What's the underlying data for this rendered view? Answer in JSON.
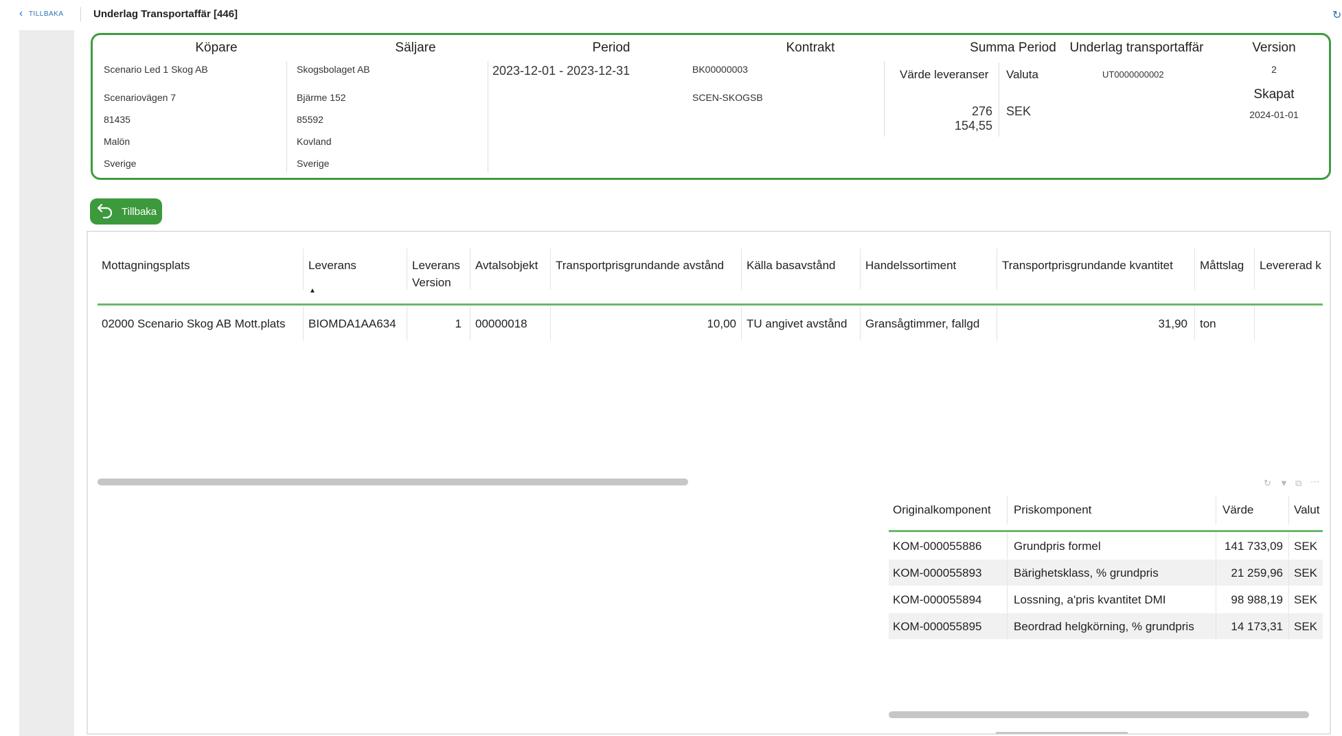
{
  "topbar": {
    "back_label": "TILLBAKA",
    "title": "Underlag Transportaffär [446]"
  },
  "header": {
    "kopare": {
      "label": "Köpare",
      "lines": [
        "Scenario Led 1 Skog AB",
        "Scenariovägen 7",
        "81435",
        "Malön",
        "Sverige"
      ]
    },
    "saljare": {
      "label": "Säljare",
      "lines": [
        "Skogsbolaget AB",
        "Bjärme 152",
        "85592",
        "Kovland",
        "Sverige"
      ]
    },
    "period": {
      "label": "Period",
      "value": "2023-12-01 - 2023-12-31"
    },
    "kontrakt": {
      "label": "Kontrakt",
      "lines": [
        "BK00000003",
        "SCEN-SKOGSB"
      ]
    },
    "summa": {
      "label": "Summa Period",
      "varde_label": "Värde leveranser",
      "valuta_label": "Valuta",
      "varde": "276 154,55",
      "valuta": "SEK"
    },
    "underlag": {
      "label": "Underlag transportaffär",
      "value": "UT0000000002"
    },
    "version": {
      "label": "Version",
      "value": "2"
    },
    "skapat": {
      "label": "Skapat",
      "value": "2024-01-01"
    }
  },
  "back_button": {
    "label": "Tillbaka"
  },
  "main_table": {
    "headers": {
      "mottagningsplats": "Mottagningsplats",
      "leverans": "Leverans",
      "leverans_version_1": "Leverans",
      "leverans_version_2": "Version",
      "avtalsobjekt": "Avtalsobjekt",
      "tp_avstand": "Transportprisgrundande avstånd",
      "kalla": "Källa basavstånd",
      "handelssortiment": "Handelssortiment",
      "tp_kvantitet": "Transportprisgrundande kvantitet",
      "mattslag": "Måttslag",
      "levererad": "Levererad k"
    },
    "row": {
      "mottagningsplats": "02000 Scenario Skog AB Mott.plats",
      "leverans": "BIOMDA1AA634",
      "leverans_version": "1",
      "avtalsobjekt": "00000018",
      "tp_avstand": "10,00",
      "kalla": "TU angivet avstånd",
      "handelssortiment": "Gransågtimmer, fallgd",
      "tp_kvantitet": "31,90",
      "mattslag": "ton"
    }
  },
  "sub_table": {
    "headers": {
      "originalkomponent": "Originalkomponent",
      "priskomponent": "Priskomponent",
      "varde": "Värde",
      "valuta": "Valut"
    },
    "rows": [
      {
        "originalkomponent": "KOM-000055886",
        "priskomponent": "Grundpris formel",
        "varde": "141 733,09",
        "valuta": "SEK"
      },
      {
        "originalkomponent": "KOM-000055893",
        "priskomponent": "Bärighetsklass, % grundpris",
        "varde": "21 259,96",
        "valuta": "SEK"
      },
      {
        "originalkomponent": "KOM-000055894",
        "priskomponent": "Lossning, a'pris kvantitet DMI",
        "varde": "98 988,19",
        "valuta": "SEK"
      },
      {
        "originalkomponent": "KOM-000055895",
        "priskomponent": "Beordrad helgkörning, % grundpris",
        "varde": "14 173,31",
        "valuta": "SEK"
      }
    ]
  },
  "icons": {
    "back": "chevron-left-icon",
    "undo": "undo-arrow-icon",
    "refresh": "refresh-icon",
    "filter": "filter-icon",
    "export": "export-icon",
    "more": "more-icon"
  },
  "colors": {
    "accent_green": "#3c9a3c",
    "link_blue": "#2c72b5"
  }
}
